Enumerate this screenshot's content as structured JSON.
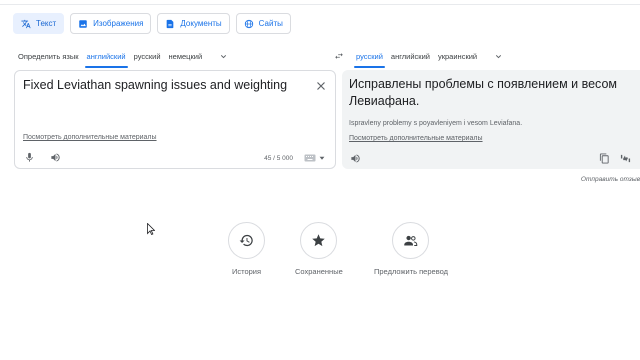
{
  "mode_tabs": [
    {
      "label": "Текст",
      "icon": "translate-icon",
      "active": true
    },
    {
      "label": "Изображения",
      "icon": "image-icon",
      "active": false
    },
    {
      "label": "Документы",
      "icon": "document-icon",
      "active": false
    },
    {
      "label": "Сайты",
      "icon": "globe-icon",
      "active": false
    }
  ],
  "source": {
    "languages": [
      "Определить язык",
      "английский",
      "русский",
      "немецкий"
    ],
    "active_language": "английский",
    "text": "Fixed Leviathan spawning issues and weighting",
    "more_materials": "Посмотреть дополнительные материалы",
    "char_count": "45 / 5 000"
  },
  "target": {
    "languages": [
      "русский",
      "английский",
      "украинский"
    ],
    "active_language": "русский",
    "text": "Исправлены проблемы с появлением и весом Левиафана.",
    "transliteration": "Ispravleny problemy s poyavleniyem i vesom Leviafana.",
    "more_materials": "Посмотреть дополнительные материалы",
    "send_feedback": "Отправить отзыв"
  },
  "quick_actions": [
    {
      "label": "История",
      "icon": "history-icon"
    },
    {
      "label": "Сохраненные",
      "icon": "star-icon"
    },
    {
      "label": "Предложить перевод",
      "icon": "people-icon"
    }
  ],
  "colors": {
    "accent": "#1a73e8",
    "active_tab_bg": "#e8f0fe",
    "target_bg": "#f1f3f4",
    "border": "#dadce0",
    "icon_gray": "#5f6368"
  }
}
